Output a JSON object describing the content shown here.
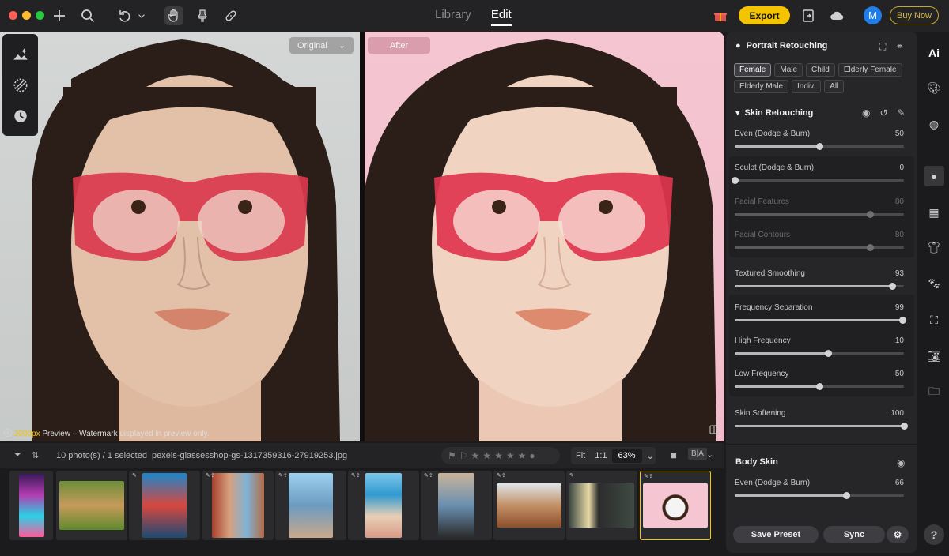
{
  "header": {
    "tabs": [
      {
        "label": "Library"
      },
      {
        "label": "Edit"
      }
    ],
    "export_label": "Export",
    "avatar_initial": "M",
    "buy_now_label": "Buy Now"
  },
  "canvas": {
    "original_label": "Original",
    "after_label": "After",
    "watermark_highlight": "3000px",
    "watermark_text": " Preview – Watermark displayed in preview only."
  },
  "filmstrip": {
    "count_text": "10 photo(s) / 1 selected",
    "filename": "pexels-glassesshop-gs-1317359316-27919253.jpg",
    "zoom": {
      "fit": "Fit",
      "one_to_one": "1:1",
      "percent": "63%"
    }
  },
  "panel": {
    "title": "Portrait Retouching",
    "chips": [
      "Female",
      "Male",
      "Child",
      "Elderly Female",
      "Elderly Male",
      "Indiv.",
      "All"
    ],
    "active_chip": "Female",
    "skin_section": "Skin Retouching",
    "sliders": [
      {
        "label": "Even (Dodge & Burn)",
        "value": "50",
        "pct": 0.5
      },
      {
        "label": "Sculpt (Dodge & Burn)",
        "value": "0",
        "pct": 0.0
      },
      {
        "label": "Facial Features",
        "value": "80",
        "pct": 0.8
      },
      {
        "label": "Facial Contours",
        "value": "80",
        "pct": 0.8
      },
      {
        "label": "Textured Smoothing",
        "value": "93",
        "pct": 0.93
      },
      {
        "label": "Frequency Separation",
        "value": "99",
        "pct": 0.99
      },
      {
        "label": "High Frequency",
        "value": "10",
        "pct": 0.55
      },
      {
        "label": "Low Frequency",
        "value": "50",
        "pct": 0.5
      },
      {
        "label": "Skin Softening",
        "value": "100",
        "pct": 1.0
      }
    ],
    "body_section": "Body Skin",
    "body_slider": {
      "label": "Even (Dodge & Burn)",
      "value": "66",
      "pct": 0.66
    },
    "save_preset": "Save Preset",
    "sync": "Sync"
  },
  "rail": {
    "ai_label": "Ai",
    "help": "?"
  }
}
